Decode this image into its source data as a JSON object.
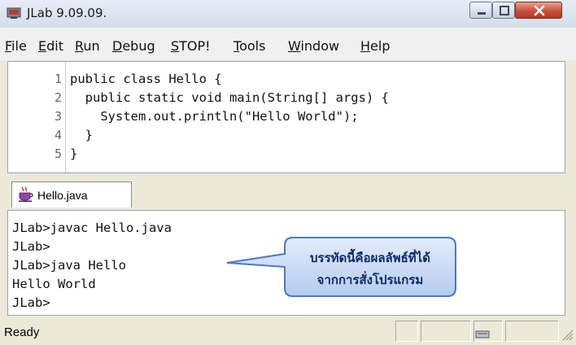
{
  "window": {
    "title": "JLab 9.09.09."
  },
  "menu": [
    {
      "key": "F",
      "rest": "ile"
    },
    {
      "key": "E",
      "rest": "dit"
    },
    {
      "key": "R",
      "rest": "un"
    },
    {
      "key": "D",
      "rest": "ebug"
    },
    {
      "key": "S",
      "rest": "TOP!"
    },
    {
      "key": "T",
      "rest": "ools"
    },
    {
      "key": "W",
      "rest": "indow"
    },
    {
      "key": "H",
      "rest": "elp"
    }
  ],
  "editor": {
    "line_numbers": [
      "1",
      "2",
      "3",
      "4",
      "5"
    ],
    "lines": [
      "public class Hello {",
      "  public static void main(String[] args) {",
      "    System.out.println(\"Hello World\");",
      "  }",
      "}"
    ]
  },
  "tab": {
    "label": "Hello.java"
  },
  "console": {
    "lines": [
      "JLab>javac Hello.java",
      "JLab>",
      "JLab>java Hello",
      "Hello World",
      "JLab>"
    ]
  },
  "callout": {
    "line1": "บรรทัดนี้คือผลลัพธ์ที่ได้",
    "line2": "จากการสั่งโปรแกรม"
  },
  "status": {
    "text": "Ready"
  },
  "colors": {
    "callout_fill": "#c6d7f5",
    "callout_border": "#4a78c7",
    "close_button": "#c8513a"
  }
}
